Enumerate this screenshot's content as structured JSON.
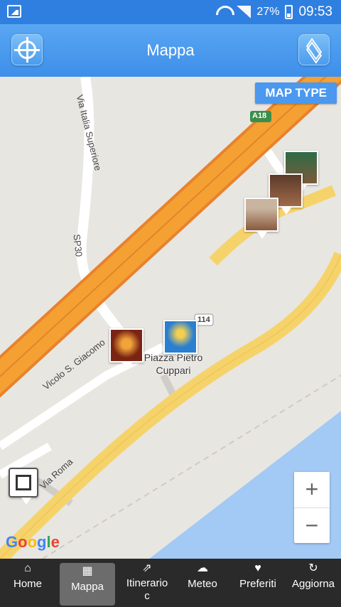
{
  "status_bar": {
    "battery": "27%",
    "time": "09:53"
  },
  "app_bar": {
    "title": "Mappa",
    "locate_icon": "crosshair-icon",
    "layers_icon": "layers-icon"
  },
  "map": {
    "map_type_label": "MAP TYPE",
    "zoom_in": "+",
    "zoom_out": "−",
    "google_logo": [
      "G",
      "o",
      "o",
      "g",
      "l",
      "e"
    ],
    "place_label_line1": "Piazza Pietro",
    "place_label_line2": "Cuppari",
    "road_labels": {
      "via_italia": "Via Italia Superiore",
      "sp30": "SP30",
      "vicolo": "Vicolo S. Giacomo",
      "via_roma": "Via Roma",
      "a18": "A18",
      "ss114": "114"
    }
  },
  "nav": {
    "items": [
      {
        "label": "Home",
        "icon": "home-icon"
      },
      {
        "label": "Mappa",
        "icon": "map-icon"
      },
      {
        "label": "Itinerario\nc",
        "icon": "route-icon"
      },
      {
        "label": "Meteo",
        "icon": "cloud-icon"
      },
      {
        "label": "Preferiti",
        "icon": "heart-icon"
      },
      {
        "label": "Aggiorna",
        "icon": "refresh-icon"
      }
    ]
  },
  "colors": {
    "status_bar": "#2f7fe0",
    "app_bar": "#4a98ef",
    "highway": "#f5a033",
    "main_road": "#f6d36a",
    "sea": "#a3c9f5",
    "land": "#e8e6e1",
    "nav_bar": "#2a2a2a"
  }
}
